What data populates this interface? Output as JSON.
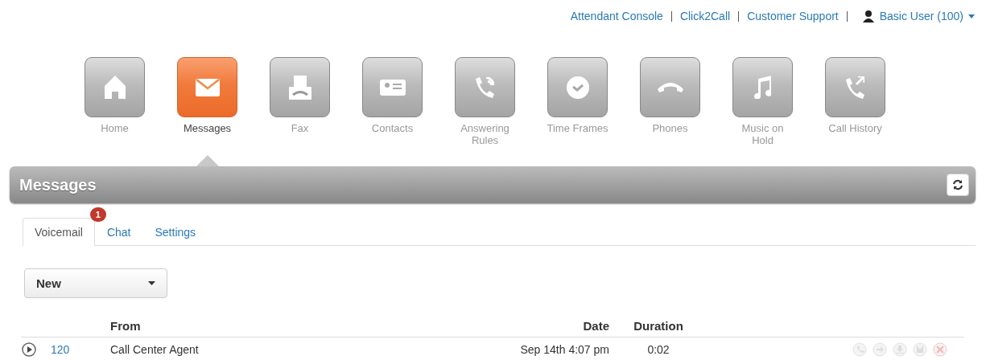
{
  "top_links": [
    {
      "label": "Attendant Console"
    },
    {
      "label": "Click2Call"
    },
    {
      "label": "Customer Support"
    }
  ],
  "user_menu": {
    "label": "Basic User (100)"
  },
  "nav": [
    {
      "label": "Home",
      "selected": false
    },
    {
      "label": "Messages",
      "selected": true
    },
    {
      "label": "Fax",
      "selected": false
    },
    {
      "label": "Contacts",
      "selected": false
    },
    {
      "label": "Answering Rules",
      "selected": false
    },
    {
      "label": "Time Frames",
      "selected": false
    },
    {
      "label": "Phones",
      "selected": false
    },
    {
      "label": "Music on Hold",
      "selected": false
    },
    {
      "label": "Call History",
      "selected": false
    }
  ],
  "panel": {
    "title": "Messages"
  },
  "tabs": [
    {
      "label": "Voicemail",
      "selected": true,
      "badge": "1"
    },
    {
      "label": "Chat",
      "selected": false
    },
    {
      "label": "Settings",
      "selected": false
    }
  ],
  "filter": {
    "value": "New"
  },
  "table": {
    "columns": [
      "From",
      "Date",
      "Duration"
    ],
    "rows": [
      {
        "number": "120",
        "from": "Call Center Agent",
        "date": "Sep 14th 4:07 pm",
        "duration": "0:02"
      }
    ]
  }
}
